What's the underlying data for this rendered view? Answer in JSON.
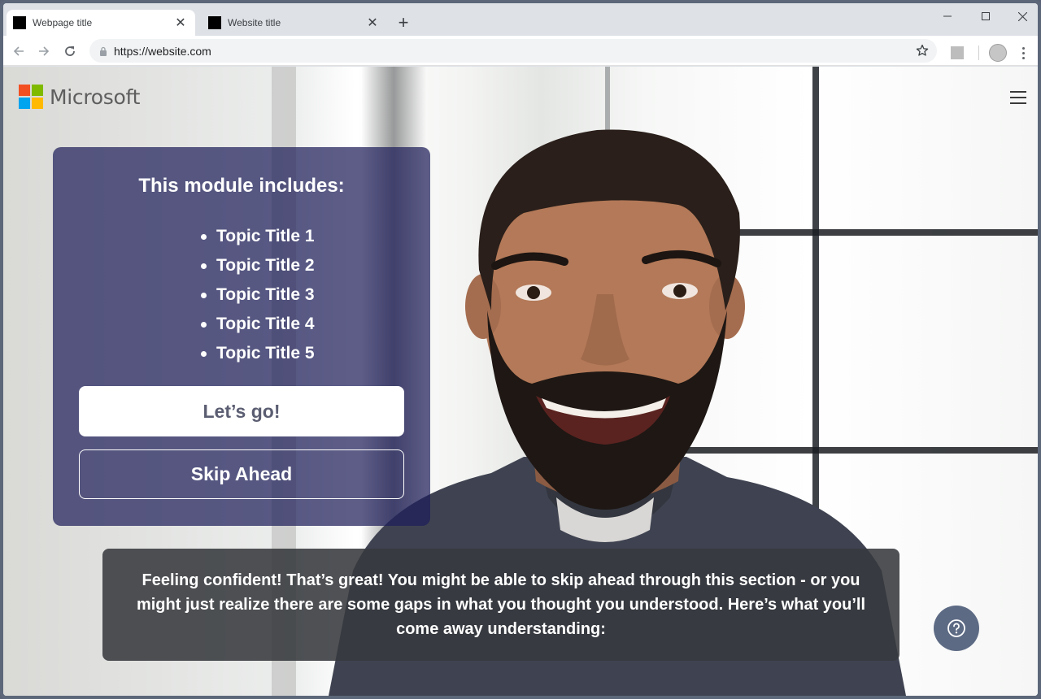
{
  "browser": {
    "tabs": [
      {
        "title": "Webpage title",
        "active": true
      },
      {
        "title": "Website title",
        "active": false
      }
    ],
    "url": "https://website.com",
    "icons": [
      "back-arrow-icon",
      "forward-arrow-icon",
      "reload-icon",
      "lock-icon",
      "star-icon",
      "extension-icon",
      "profile-icon",
      "more-menu-icon",
      "new-tab-icon",
      "minimize-icon",
      "maximize-icon",
      "close-icon"
    ]
  },
  "page": {
    "brand": "Microsoft",
    "brand_colors": {
      "red": "#f25022",
      "green": "#7fba00",
      "blue": "#00a4ef",
      "yellow": "#ffb900"
    },
    "module": {
      "title": "This module includes:",
      "topics": [
        "Topic Title 1",
        "Topic Title 2",
        "Topic Title 3",
        "Topic Title 4",
        "Topic Title 5"
      ],
      "primary_button": "Let’s go!",
      "secondary_button": "Skip Ahead"
    },
    "caption": "Feeling confident! That’s great! You might be able to skip ahead through this section - or you might just realize there are some gaps in what you thought you understood. Here’s what you’ll come away understanding:",
    "shirt_logo": "Microsoft",
    "help_icon": "question-mark-icon",
    "menu_icon": "hamburger-menu-icon"
  }
}
